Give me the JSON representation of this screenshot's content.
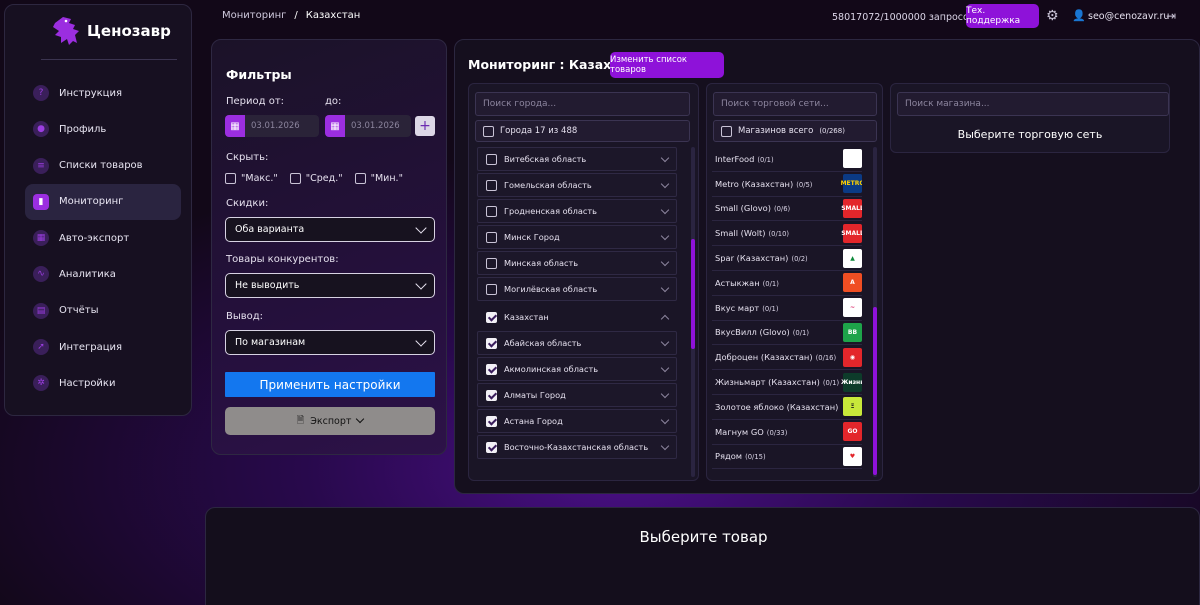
{
  "app": {
    "logo_text": "Ценозавр"
  },
  "sidebar": {
    "items": [
      {
        "label": "Инструкция",
        "icon": "question-icon"
      },
      {
        "label": "Профиль",
        "icon": "user-icon"
      },
      {
        "label": "Списки товаров",
        "icon": "list-icon"
      },
      {
        "label": "Мониторинг",
        "icon": "bar-chart-icon",
        "active": true
      },
      {
        "label": "Авто-экспорт",
        "icon": "calendar-icon"
      },
      {
        "label": "Аналитика",
        "icon": "pulse-icon"
      },
      {
        "label": "Отчёты",
        "icon": "document-icon"
      },
      {
        "label": "Интеграция",
        "icon": "rocket-icon"
      },
      {
        "label": "Настройки",
        "icon": "gear-icon"
      }
    ]
  },
  "topbar": {
    "breadcrumb_root": "Мониторинг",
    "breadcrumb_sep": "/",
    "breadcrumb_current": "Казахстан",
    "quota": "58017072/1000000 запросов",
    "support_label": "Тех. поддержка",
    "user_email": "seo@cenozavr.ru"
  },
  "filters": {
    "title": "Фильтры",
    "period_from_label": "Период от:",
    "period_to_label": "до:",
    "date_from": "03.01.2026",
    "date_to": "03.01.2026",
    "hide_label": "Скрыть:",
    "hide_options": [
      "\"Макс.\"",
      "\"Сред.\"",
      "\"Мин.\""
    ],
    "discounts_label": "Скидки:",
    "discounts_value": "Оба варианта",
    "competitors_label": "Товары конкурентов:",
    "competitors_value": "Не выводить",
    "output_label": "Вывод:",
    "output_value": "По магазинам",
    "apply_label": "Применить настройки",
    "export_label": "Экспорт"
  },
  "monitoring": {
    "title": "Мониторинг : Казахстан",
    "change_list_label": "Изменить список товаров",
    "city_search_placeholder": "Поиск города...",
    "cities_all_label": "Города 17 из 488",
    "regions": [
      {
        "name": "Витебская область",
        "checked": false,
        "kind": "child"
      },
      {
        "name": "Гомельская область",
        "checked": false,
        "kind": "child"
      },
      {
        "name": "Гродненская область",
        "checked": false,
        "kind": "child"
      },
      {
        "name": "Минск Город",
        "checked": false,
        "kind": "child"
      },
      {
        "name": "Минская область",
        "checked": false,
        "kind": "child"
      },
      {
        "name": "Могилёвская область",
        "checked": false,
        "kind": "child"
      },
      {
        "name": "Казахстан",
        "checked": true,
        "kind": "group"
      },
      {
        "name": "Абайская область",
        "checked": true,
        "kind": "child"
      },
      {
        "name": "Акмолинская область",
        "checked": true,
        "kind": "child"
      },
      {
        "name": "Алматы Город",
        "checked": true,
        "kind": "child"
      },
      {
        "name": "Астана Город",
        "checked": true,
        "kind": "child"
      },
      {
        "name": "Восточно-Казахстанская область",
        "checked": true,
        "kind": "child"
      }
    ],
    "chain_search_placeholder": "Поиск торговой сети...",
    "chains_all_label": "Магазинов всего",
    "chains_all_count": "(0/268)",
    "chains": [
      {
        "name": "InterFood",
        "count": "(0/1)",
        "logo_color": "#ffffff",
        "logo_text": "",
        "logo_fg": "#e21b3c"
      },
      {
        "name": "Metro (Казахстан)",
        "count": "(0/5)",
        "logo_color": "#0b3a84",
        "logo_text": "METRO",
        "logo_fg": "#ffd200"
      },
      {
        "name": "Small (Glovo)",
        "count": "(0/6)",
        "logo_color": "#e3262b",
        "logo_text": "SMALL",
        "logo_fg": "#ffffff"
      },
      {
        "name": "Small (Wolt)",
        "count": "(0/10)",
        "logo_color": "#e3262b",
        "logo_text": "SMALL",
        "logo_fg": "#ffffff"
      },
      {
        "name": "Spar (Казахстан)",
        "count": "(0/2)",
        "logo_color": "#ffffff",
        "logo_text": "▲",
        "logo_fg": "#0f8a3c"
      },
      {
        "name": "Астыкжан",
        "count": "(0/1)",
        "logo_color": "#f04e23",
        "logo_text": "A",
        "logo_fg": "#ffffff"
      },
      {
        "name": "Вкус март",
        "count": "(0/1)",
        "logo_color": "#ffffff",
        "logo_text": "~",
        "logo_fg": "#d81b60"
      },
      {
        "name": "ВкусВилл (Glovo)",
        "count": "(0/1)",
        "logo_color": "#1ea34a",
        "logo_text": "BB",
        "logo_fg": "#ffffff"
      },
      {
        "name": "Доброцен (Казахстан)",
        "count": "(0/16)",
        "logo_color": "#e3262b",
        "logo_text": "◉",
        "logo_fg": "#ffffff"
      },
      {
        "name": "Жизньмарт (Казахстан)",
        "count": "(0/1)",
        "logo_color": "#0d3b2a",
        "logo_text": "Жизнь",
        "logo_fg": "#ffffff"
      },
      {
        "name": "Золотое яблоко (Казахстан)",
        "count": "(0/3)",
        "logo_color": "#c8e83a",
        "logo_text": "Ξ",
        "logo_fg": "#1a1a1a"
      },
      {
        "name": "Магнум GO",
        "count": "(0/33)",
        "logo_color": "#e3262b",
        "logo_text": "GO",
        "logo_fg": "#ffffff"
      },
      {
        "name": "Рядом",
        "count": "(0/15)",
        "logo_color": "#ffffff",
        "logo_text": "♥",
        "logo_fg": "#e3262b"
      }
    ],
    "store_search_placeholder": "Поиск магазина...",
    "store_message": "Выберите торговую сеть"
  },
  "product_panel": {
    "message": "Выберите товар"
  },
  "colors": {
    "accent": "#8e12d9",
    "apply_button": "#1377ef",
    "export_button": "#8f8c8b"
  }
}
